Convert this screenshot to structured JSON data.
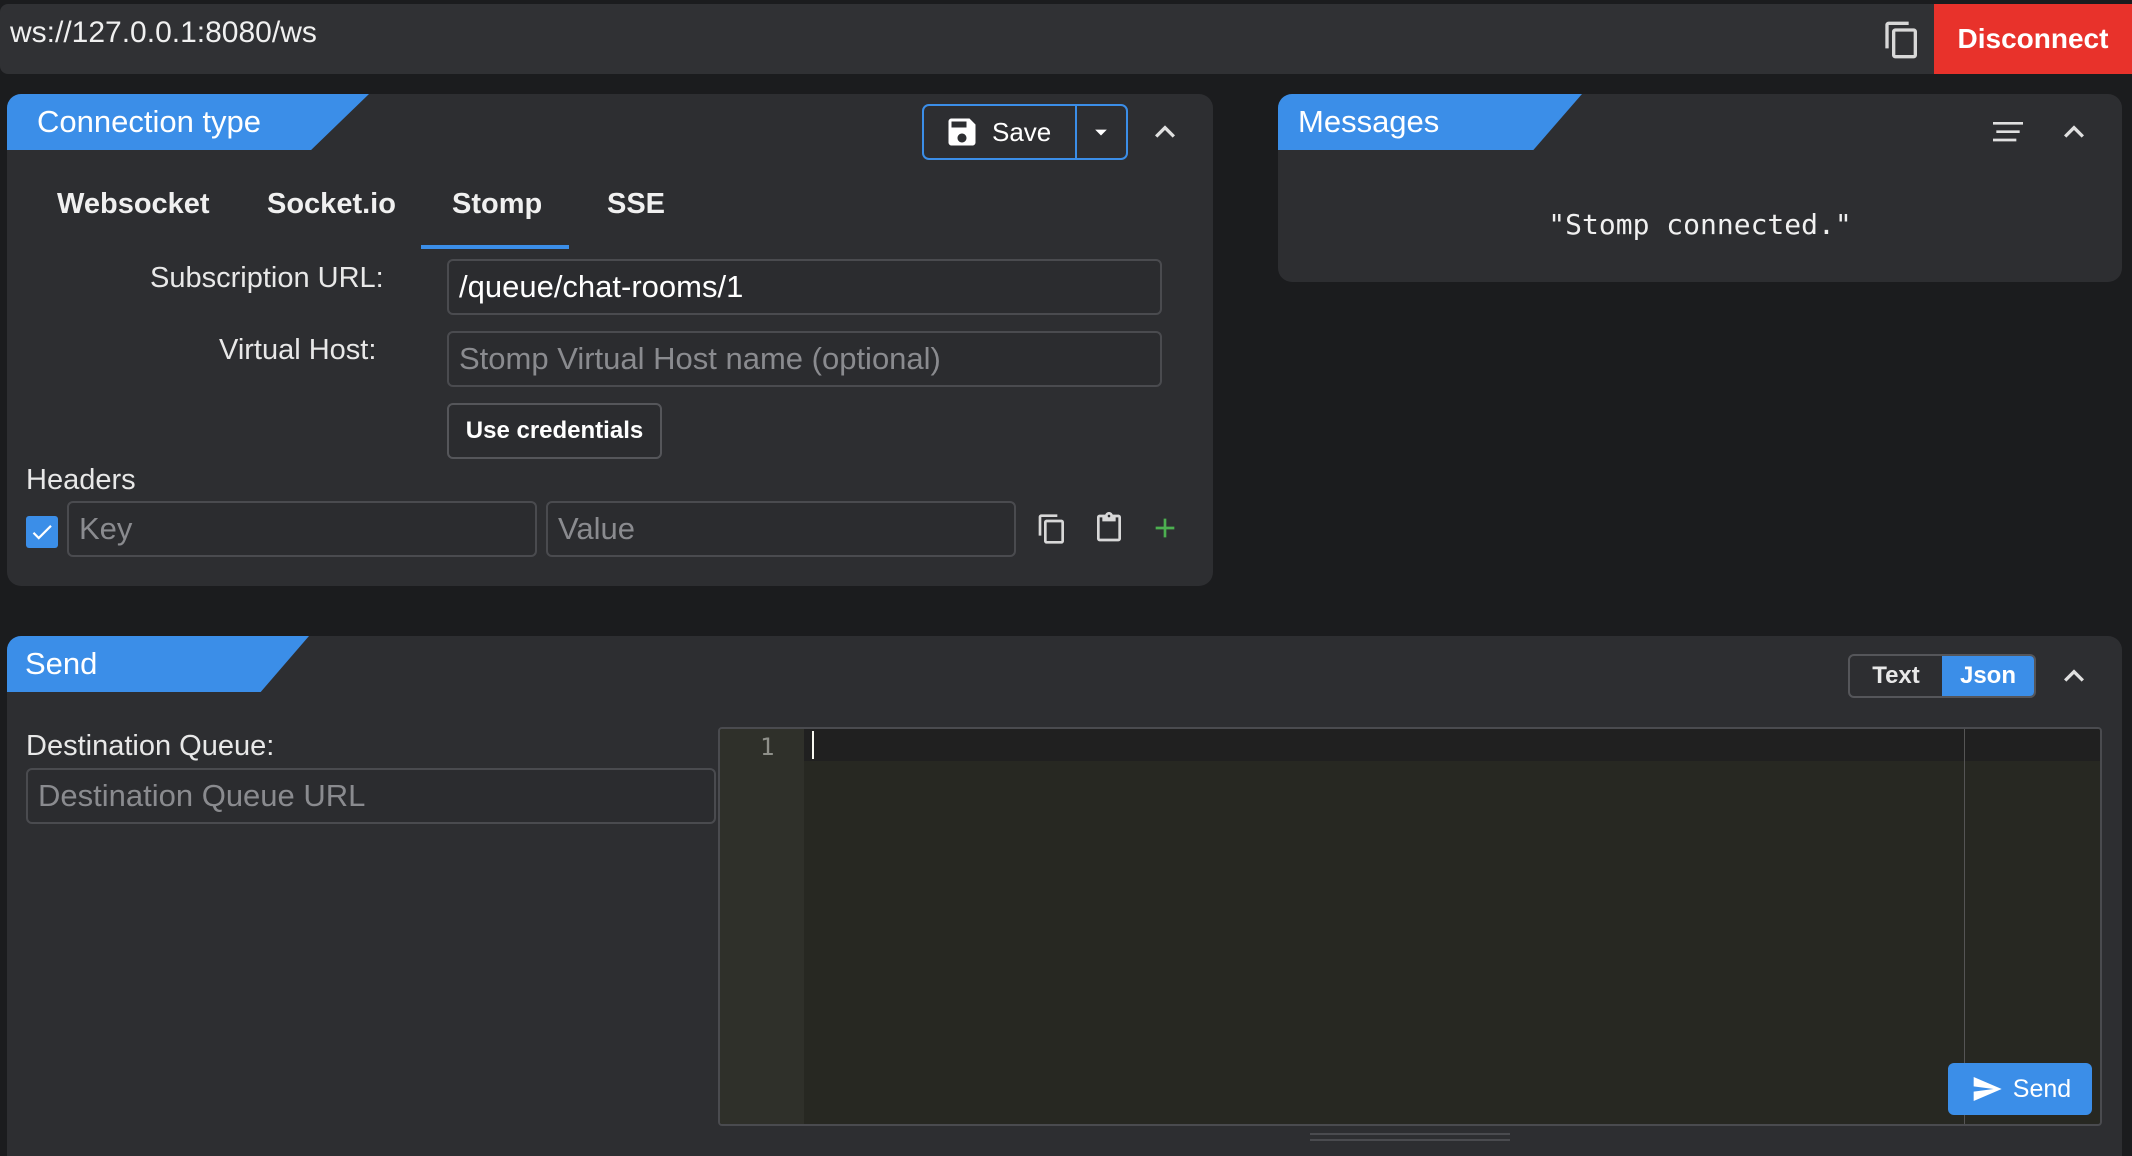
{
  "urlbar": {
    "url": "ws://127.0.0.1:8080/ws",
    "disconnect_label": "Disconnect"
  },
  "connection": {
    "title": "Connection type",
    "save_label": "Save",
    "tabs": [
      {
        "label": "Websocket"
      },
      {
        "label": "Socket.io"
      },
      {
        "label": "Stomp",
        "active": true
      },
      {
        "label": "SSE"
      }
    ],
    "subscription_label": "Subscription URL:",
    "subscription_value": "/queue/chat-rooms/1",
    "vhost_label": "Virtual Host:",
    "vhost_placeholder": "Stomp Virtual Host name (optional)",
    "use_credentials_label": "Use credentials",
    "headers_label": "Headers",
    "header_key_placeholder": "Key",
    "header_value_placeholder": "Value",
    "header_checked": true
  },
  "messages": {
    "title": "Messages",
    "items": [
      "\"Stomp connected.\""
    ]
  },
  "send": {
    "title": "Send",
    "modes": [
      {
        "label": "Text"
      },
      {
        "label": "Json",
        "active": true
      }
    ],
    "destination_label": "Destination Queue:",
    "destination_placeholder": "Destination Queue URL",
    "editor_line": "1",
    "send_label": "Send"
  },
  "colors": {
    "accent": "#3b8ee8",
    "danger": "#e8322b",
    "add": "#4caf50"
  }
}
